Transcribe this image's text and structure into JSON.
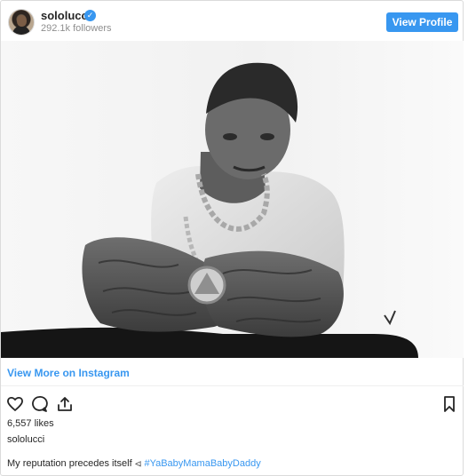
{
  "profile": {
    "username": "sololucci",
    "followers": "292.1k followers",
    "verified_icon": "check-badge-icon",
    "view_profile_label": "View Profile"
  },
  "post": {
    "view_more_label": "View More on Instagram",
    "likes": "6,557 likes",
    "owner_label": "sololucci",
    "caption_text": "My reputation precedes itself ⏿ ",
    "hashtag": "#YaBabyMamaBabyDaddy"
  },
  "icons": {
    "like": "heart-icon",
    "comment": "comment-icon",
    "share": "share-icon",
    "save": "bookmark-icon"
  },
  "colors": {
    "accent": "#3897f0",
    "text": "#262626",
    "muted": "#8e8e8e",
    "border": "#dbdbdb"
  }
}
